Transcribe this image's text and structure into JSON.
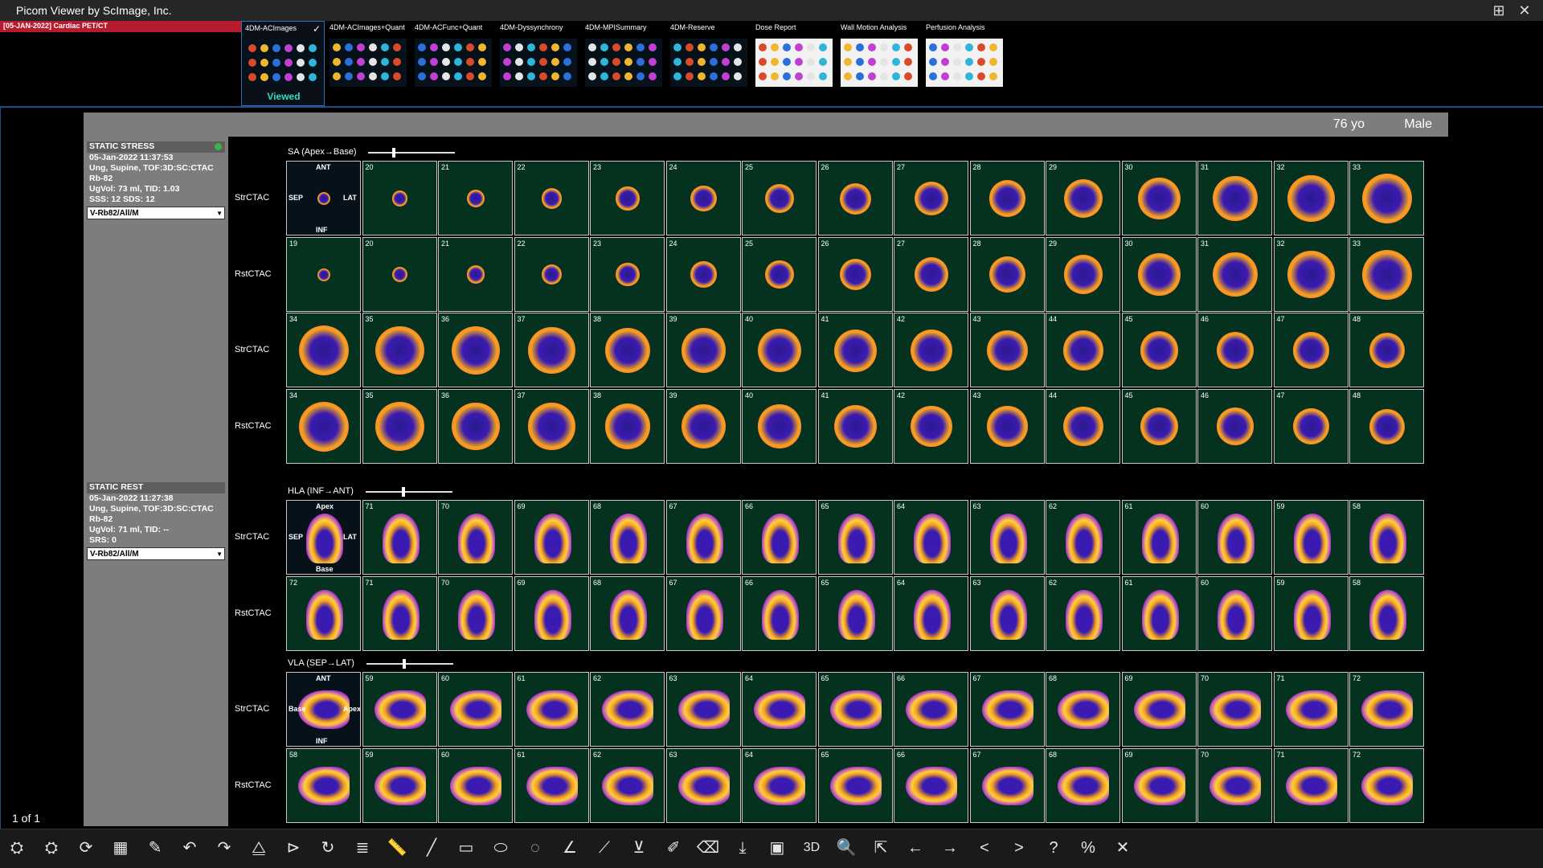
{
  "window": {
    "title": "Picom Viewer by ScImage, Inc."
  },
  "study": {
    "label": "[05-JAN-2022] Cardiac PET/CT"
  },
  "tabs": [
    {
      "label": "4DM-ACImages",
      "viewed": "Viewed"
    },
    {
      "label": "4DM-ACImages+Quant"
    },
    {
      "label": "4DM-ACFunc+Quant"
    },
    {
      "label": "4DM-Dyssynchrony"
    },
    {
      "label": "4DM-MPISummary"
    },
    {
      "label": "4DM-Reserve"
    },
    {
      "label": "Dose Report"
    },
    {
      "label": "Wall Motion Analysis"
    },
    {
      "label": "Perfusion Analysis"
    }
  ],
  "patient": {
    "age": "76 yo",
    "sex": "Male"
  },
  "stress_panel": {
    "title": "STATIC STRESS",
    "datetime": "05-Jan-2022 11:37:53",
    "protocol": "Ung, Supine, TOF:3D:SC:CTAC",
    "tracer": "Rb-82",
    "volume": "UgVol: 73 ml, TID: 1.03",
    "scores": "SSS: 12    SDS: 12",
    "selection": "V-Rb82/All/M"
  },
  "rest_panel": {
    "title": "STATIC REST",
    "datetime": "05-Jan-2022 11:27:38",
    "protocol": "Ung, Supine, TOF:3D:SC:CTAC",
    "tracer": "Rb-82",
    "volume": "UgVol: 71 ml, TID: --",
    "scores": "SRS: 0",
    "selection": "V-Rb82/All/M"
  },
  "page_counter": "1 of 1",
  "sections": {
    "sa": {
      "label": "SA (Apex→Base)",
      "row_labels": [
        "StrCTAC",
        "RstCTAC",
        "StrCTAC",
        "RstCTAC"
      ],
      "rows": [
        [
          "",
          "20",
          "21",
          "22",
          "23",
          "24",
          "25",
          "26",
          "27",
          "28",
          "29",
          "30",
          "31",
          "32",
          "33"
        ],
        [
          "19",
          "20",
          "21",
          "22",
          "23",
          "24",
          "25",
          "26",
          "27",
          "28",
          "29",
          "30",
          "31",
          "32",
          "33"
        ],
        [
          "34",
          "35",
          "36",
          "37",
          "38",
          "39",
          "40",
          "41",
          "42",
          "43",
          "44",
          "45",
          "46",
          "47",
          "48"
        ],
        [
          "34",
          "35",
          "36",
          "37",
          "38",
          "39",
          "40",
          "41",
          "42",
          "43",
          "44",
          "45",
          "46",
          "47",
          "48"
        ]
      ],
      "orient": {
        "top": "ANT",
        "left": "SEP",
        "right": "LAT",
        "bottom": "INF"
      }
    },
    "hla": {
      "label": "HLA (INF→ANT)",
      "row_labels": [
        "StrCTAC",
        "RstCTAC"
      ],
      "rows": [
        [
          "",
          "71",
          "70",
          "69",
          "68",
          "67",
          "66",
          "65",
          "64",
          "63",
          "62",
          "61",
          "60",
          "59",
          "58"
        ],
        [
          "72",
          "71",
          "70",
          "69",
          "68",
          "67",
          "66",
          "65",
          "64",
          "63",
          "62",
          "61",
          "60",
          "59",
          "58"
        ]
      ],
      "orient": {
        "top": "Apex",
        "left": "SEP",
        "right": "LAT",
        "bottom": "Base"
      }
    },
    "vla": {
      "label": "VLA (SEP→LAT)",
      "row_labels": [
        "StrCTAC",
        "RstCTAC"
      ],
      "rows": [
        [
          "",
          "59",
          "60",
          "61",
          "62",
          "63",
          "64",
          "65",
          "66",
          "67",
          "68",
          "69",
          "70",
          "71",
          "72"
        ],
        [
          "58",
          "59",
          "60",
          "61",
          "62",
          "63",
          "64",
          "65",
          "66",
          "67",
          "68",
          "69",
          "70",
          "71",
          "72"
        ]
      ],
      "orient": {
        "top": "ANT",
        "left": "Base",
        "right": "Apex",
        "bottom": "INF"
      }
    }
  },
  "toolbar": {
    "items": [
      {
        "name": "patient-tool-icon",
        "glyph": "⛭"
      },
      {
        "name": "patient-compare-icon",
        "glyph": "⛭"
      },
      {
        "name": "refresh-icon",
        "glyph": "⟳"
      },
      {
        "name": "film-icon",
        "glyph": "▦"
      },
      {
        "name": "edit-image-icon",
        "glyph": "✎"
      },
      {
        "name": "rotate-left-icon",
        "glyph": "↶"
      },
      {
        "name": "rotate-right-icon",
        "glyph": "↷"
      },
      {
        "name": "flip-horizontal-icon",
        "glyph": "⧋"
      },
      {
        "name": "flip-vertical-icon",
        "glyph": "⊳"
      },
      {
        "name": "reset-icon",
        "glyph": "↻"
      },
      {
        "name": "text-annotate-icon",
        "glyph": "≣"
      },
      {
        "name": "ruler-icon",
        "glyph": "📏"
      },
      {
        "name": "line-icon",
        "glyph": "╱"
      },
      {
        "name": "rectangle-icon",
        "glyph": "▭"
      },
      {
        "name": "ellipse-icon",
        "glyph": "⬭"
      },
      {
        "name": "freehand-roi-icon",
        "glyph": "◌"
      },
      {
        "name": "angle-icon",
        "glyph": "∠"
      },
      {
        "name": "arrow-line-icon",
        "glyph": "⟋"
      },
      {
        "name": "cobb-angle-icon",
        "glyph": "⊻"
      },
      {
        "name": "pen-icon",
        "glyph": "✐"
      },
      {
        "name": "eraser-icon",
        "glyph": "⌫"
      },
      {
        "name": "download-icon",
        "glyph": "⤓"
      },
      {
        "name": "layout-grid-icon",
        "glyph": "▣"
      },
      {
        "name": "3d-icon",
        "glyph": "3D"
      },
      {
        "name": "zoom-icon",
        "glyph": "🔍"
      },
      {
        "name": "export-icon",
        "glyph": "⇱"
      },
      {
        "name": "arrow-left-icon",
        "glyph": "←"
      },
      {
        "name": "arrow-right-icon",
        "glyph": "→"
      },
      {
        "name": "chevron-left-icon",
        "glyph": "<"
      },
      {
        "name": "chevron-right-icon",
        "glyph": ">"
      },
      {
        "name": "help-icon",
        "glyph": "?"
      },
      {
        "name": "percent-tool-icon",
        "glyph": "%"
      },
      {
        "name": "close-tool-icon",
        "glyph": "✕"
      }
    ]
  },
  "colors": {
    "accent_red": "#b71c2e",
    "viewed_text": "#2ee0c2",
    "panel_gray": "#7d7d7d"
  }
}
